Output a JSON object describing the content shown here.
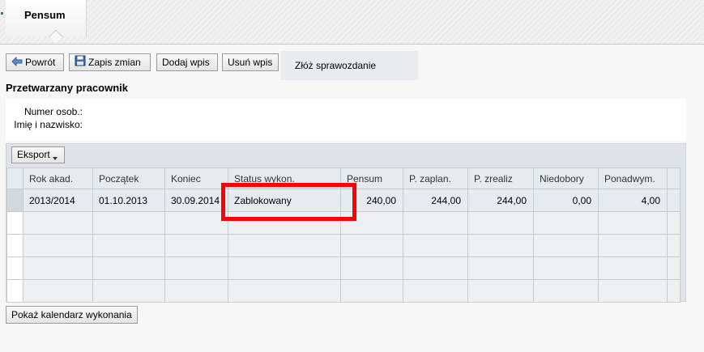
{
  "tab": {
    "label": "Pensum"
  },
  "toolbar": {
    "back_label": "Powrót",
    "save_label": "Zapis zmian",
    "add_label": "Dodaj wpis",
    "delete_label": "Usuń wpis",
    "submit_label": "Złóż sprawozdanie"
  },
  "employee": {
    "section_title": "Przetwarzany pracownik",
    "number_label": "Numer osob.:",
    "name_label": "Imię i nazwisko:"
  },
  "table": {
    "export_label": "Eksport",
    "columns": [
      "Rok akad.",
      "Początek",
      "Koniec",
      "Status wykon.",
      "Pensum",
      "P. zaplan.",
      "P. zrealiz",
      "Niedobory",
      "Ponadwym."
    ],
    "rows": [
      [
        "2013/2014",
        "01.10.2013",
        "30.09.2014",
        "Zablokowany",
        "240,00",
        "244,00",
        "244,00",
        "0,00",
        "4,00"
      ]
    ]
  },
  "calendar_button_label": "Pokaż kalendarz wykonania",
  "colors": {
    "highlight": "#ff0000"
  }
}
